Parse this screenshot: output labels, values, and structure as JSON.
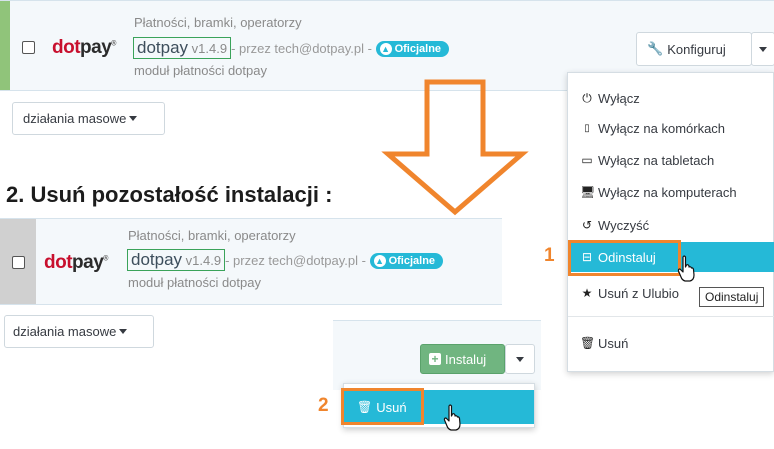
{
  "module_top": {
    "category": "Płatności, bramki, operatorzy",
    "name": "dotpay",
    "version": "v1.4.9",
    "author": "- przez tech@dotpay.pl -",
    "badge": "Oficjalne",
    "description": "moduł płatności dotpay",
    "logo_red": "dot",
    "logo_dark": "pay"
  },
  "module_bottom": {
    "category": "Płatności, bramki, operatorzy",
    "name": "dotpay",
    "version": "v1.4.9",
    "author": "- przez tech@dotpay.pl -",
    "badge": "Oficjalne",
    "description": "moduł płatności dotpay",
    "logo_red": "dot",
    "logo_dark": "pay"
  },
  "bulk_actions_label": "działania masowe",
  "configure_label": "Konfiguruj",
  "install_label": "Instaluj",
  "heading": "2. Usuń pozostałość instalacji :",
  "dropdown": {
    "items": [
      {
        "icon": "power-icon",
        "label": "Wyłącz"
      },
      {
        "icon": "mobile-icon",
        "label": "Wyłącz na komórkach"
      },
      {
        "icon": "tablet-icon",
        "label": "Wyłącz na tabletach"
      },
      {
        "icon": "desktop-icon",
        "label": "Wyłącz na komputerach"
      },
      {
        "icon": "undo-icon",
        "label": "Wyczyść"
      },
      {
        "icon": "minus-square-icon",
        "label": "Odinstaluj"
      },
      {
        "icon": "star-icon",
        "label": "Usuń z Ulubio"
      },
      {
        "icon": "trash-icon",
        "label": "Usuń"
      }
    ]
  },
  "tooltip": "Odinstaluj",
  "step1": "1",
  "step2": "2",
  "delete_label": "Usuń",
  "colors": {
    "accent": "#25b9d7",
    "green": "#70b580",
    "orange": "#f0852d"
  }
}
